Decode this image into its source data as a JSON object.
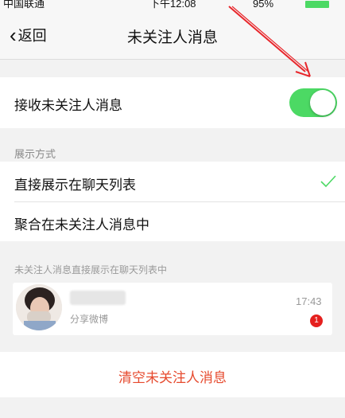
{
  "status_bar": {
    "carrier": "中国联通",
    "time": "下午12:08",
    "battery": "95%"
  },
  "nav": {
    "back_label": "返回",
    "title": "未关注人消息"
  },
  "receive": {
    "label": "接收未关注人消息",
    "enabled": true
  },
  "display": {
    "section_label": "展示方式",
    "options": [
      {
        "label": "直接展示在聊天列表",
        "selected": true
      },
      {
        "label": "聚合在未关注人消息中",
        "selected": false
      }
    ]
  },
  "preview": {
    "caption": "未关注人消息直接展示在聊天列表中",
    "message": "分享微博",
    "time": "17:43",
    "unread": "1"
  },
  "clear_button": {
    "label": "清空未关注人消息"
  },
  "colors": {
    "accent_green": "#4cd964",
    "danger_text": "#e64a2e",
    "badge_red": "#e5201e",
    "annotation_arrow": "#e8262b"
  }
}
